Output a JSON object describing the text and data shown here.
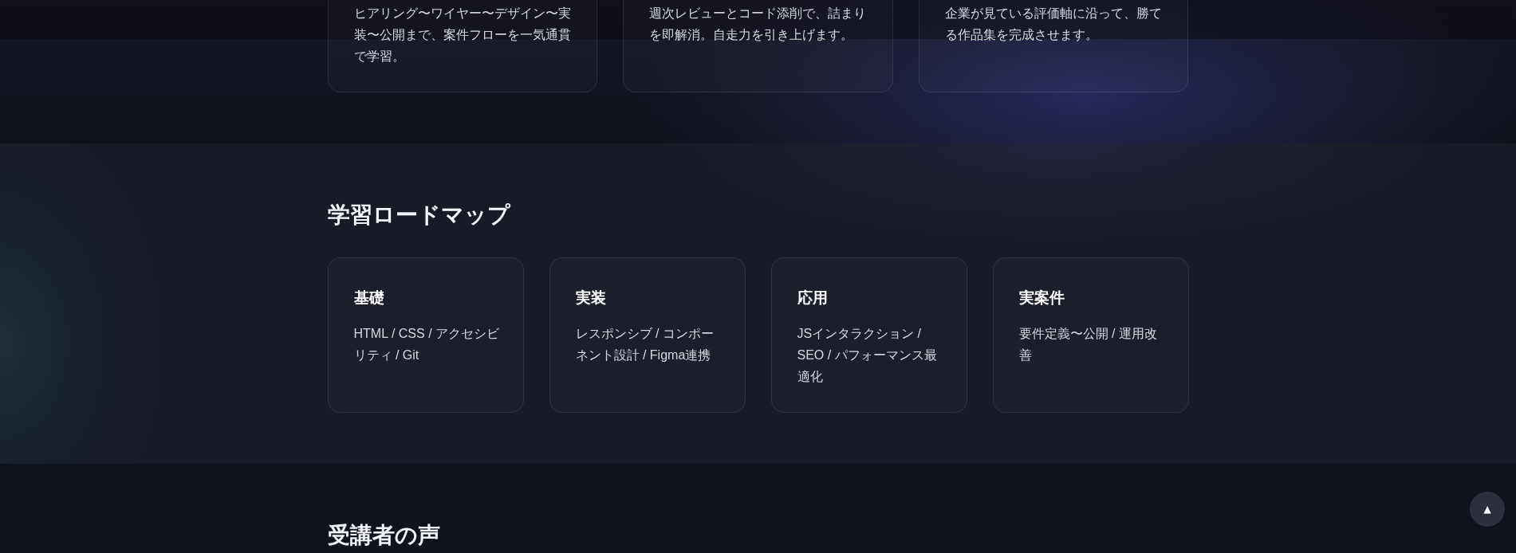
{
  "features": {
    "cards": [
      {
        "description": "ヒアリング〜ワイヤー〜デザイン〜実装〜公開まで、案件フローを一気通貫で学習。"
      },
      {
        "description": "週次レビューとコード添削で、詰まりを即解消。自走力を引き上げます。"
      },
      {
        "description": "企業が見ている評価軸に沿って、勝てる作品集を完成させます。"
      }
    ]
  },
  "roadmap": {
    "heading": "学習ロードマップ",
    "steps": [
      {
        "title": "基礎",
        "description": "HTML / CSS / アクセシビリティ / Git"
      },
      {
        "title": "実装",
        "description": "レスポンシブ / コンポーネント設計 / Figma連携"
      },
      {
        "title": "応用",
        "description": "JSインタラクション / SEO / パフォーマンス最適化"
      },
      {
        "title": "実案件",
        "description": "要件定義〜公開 / 運用改善"
      }
    ]
  },
  "testimonials": {
    "heading": "受講者の声"
  },
  "back_to_top": {
    "label": "▲"
  }
}
